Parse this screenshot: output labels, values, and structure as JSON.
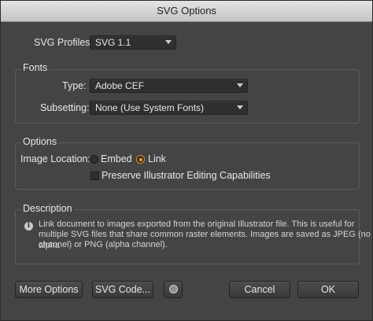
{
  "window": {
    "title": "SVG Options"
  },
  "svg_profiles": {
    "label": "SVG Profiles:",
    "value": "SVG 1.1"
  },
  "fonts": {
    "title": "Fonts",
    "type_label": "Type:",
    "type_value": "Adobe CEF",
    "subsetting_label": "Subsetting:",
    "subsetting_value": "None (Use System Fonts)"
  },
  "options": {
    "title": "Options",
    "image_location_label": "Image Location:",
    "embed_label": "Embed",
    "link_label": "Link",
    "selected": "Link",
    "preserve_label": "Preserve Illustrator Editing Capabilities",
    "preserve_checked": false
  },
  "description": {
    "title": "Description",
    "line1": "Link document to images exported from the original Illustrator file. This is useful for",
    "line2": "multiple SVG files that share common raster elements. Images are saved as JPEG (no alpha",
    "line3": "channel) or PNG (alpha channel)."
  },
  "buttons": {
    "more_options": "More Options",
    "svg_code": "SVG Code...",
    "cancel": "Cancel",
    "ok": "OK"
  },
  "icons": {
    "info": "info-icon",
    "globe": "globe-icon",
    "dropdown": "chevron-down-icon"
  },
  "colors": {
    "accent_radio": "#f0a23a",
    "background": "#444444"
  }
}
